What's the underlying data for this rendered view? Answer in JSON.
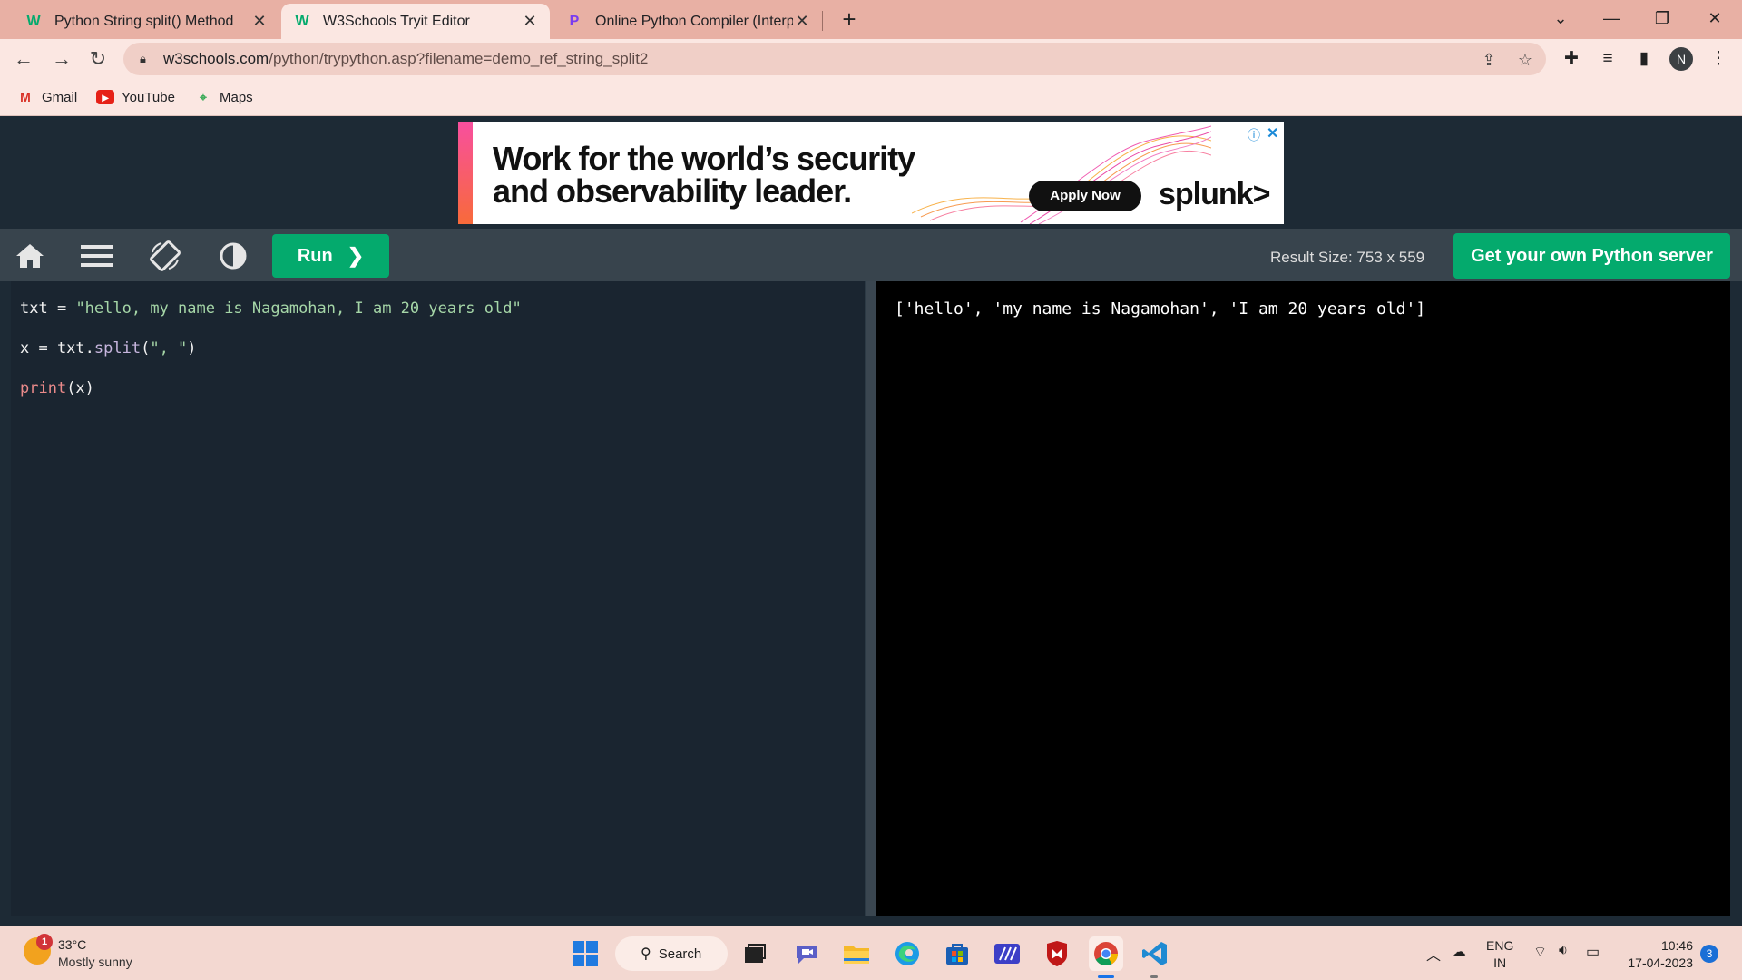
{
  "browser": {
    "tabs": [
      {
        "title": "Python String split() Method",
        "favicon": "w3schools-icon"
      },
      {
        "title": "W3Schools Tryit Editor",
        "favicon": "w3schools-icon"
      },
      {
        "title": "Online Python Compiler (Interpre",
        "favicon": "programiz-icon"
      }
    ],
    "url_host": "w3schools.com",
    "url_path": "/python/trypython.asp?filename=demo_ref_string_split2",
    "profile_initial": "N",
    "bookmarks": [
      {
        "label": "Gmail",
        "icon": "gmail-icon"
      },
      {
        "label": "YouTube",
        "icon": "youtube-icon"
      },
      {
        "label": "Maps",
        "icon": "maps-icon"
      }
    ]
  },
  "ad": {
    "line1": "Work for the world’s security",
    "line2": "and observability leader.",
    "cta": "Apply Now",
    "brand": "splunk>",
    "info": "ⓘ",
    "close": "✕"
  },
  "editor_toolbar": {
    "run_label": "Run",
    "result_size": "Result Size: 753 x 559",
    "server_button": "Get your own Python server"
  },
  "code": {
    "line1_var": "txt",
    "line1_op": " = ",
    "line1_str": "\"hello, my name is Nagamohan, I am 20 years old\"",
    "line2_a": "x = txt.",
    "line2_meth": "split",
    "line2_open": "(",
    "line2_str": "\", \"",
    "line2_close": ")",
    "line3_fn": "print",
    "line3_rest": "(x)"
  },
  "result": {
    "output": "['hello', 'my name is Nagamohan', 'I am 20 years old']"
  },
  "taskbar": {
    "weather_temp": "33°C",
    "weather_desc": "Mostly sunny",
    "weather_badge": "1",
    "search_label": "Search",
    "lang_line1": "ENG",
    "lang_line2": "IN",
    "time": "10:46",
    "date": "17-04-2023",
    "notifications": "3"
  },
  "colors": {
    "accent_green": "#04aa6d",
    "page_bg": "#1d2a35",
    "chrome_tab_bar": "#e8b0a4"
  }
}
